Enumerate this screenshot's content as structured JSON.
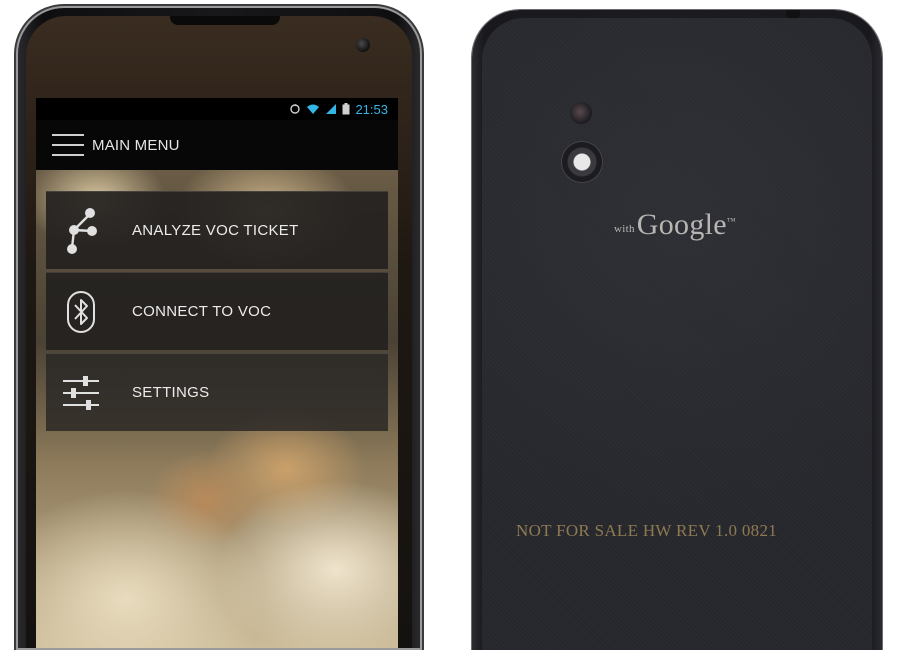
{
  "status_bar": {
    "time": "21:53",
    "icons": [
      "sync-icon",
      "wifi-icon",
      "signal-icon",
      "battery-icon"
    ]
  },
  "action_bar": {
    "title": "MAIN MENU",
    "menu_icon": "hamburger-icon"
  },
  "menu": {
    "items": [
      {
        "label": "ANALYZE VOC TICKET",
        "icon": "share-nodes-icon"
      },
      {
        "label": "CONNECT TO VOC",
        "icon": "bluetooth-icon"
      },
      {
        "label": "SETTINGS",
        "icon": "sliders-icon"
      }
    ]
  },
  "back": {
    "brand_prefix": "with",
    "brand": "Google",
    "brand_tm": "™",
    "hw_text": "NOT FOR SALE HW REV 1.0 0821"
  },
  "colors": {
    "accent": "#33b5e5",
    "menu_bg": "#232120"
  }
}
